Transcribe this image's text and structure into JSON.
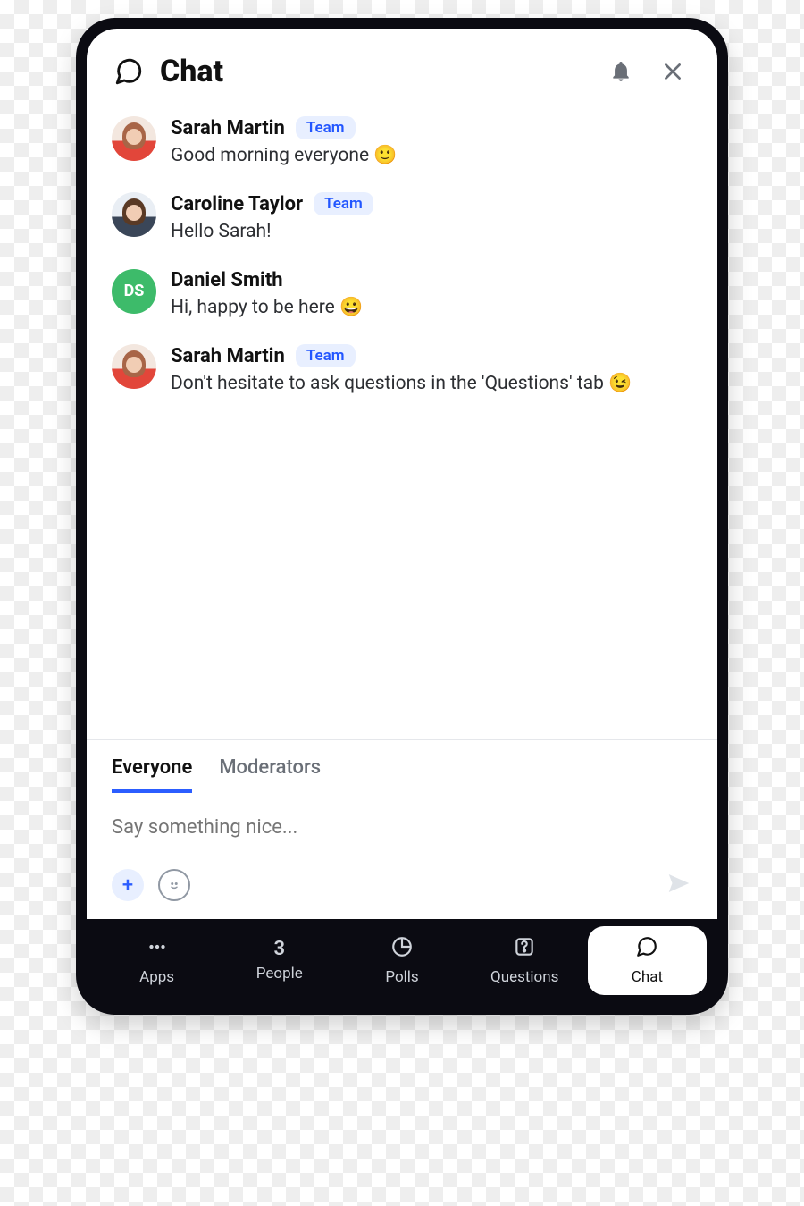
{
  "header": {
    "title": "Chat"
  },
  "badge": "Team",
  "messages": [
    {
      "name": "Sarah Martin",
      "team": true,
      "text": "Good morning everyone 🙂",
      "avatar": "sarah"
    },
    {
      "name": "Caroline Taylor",
      "team": true,
      "text": "Hello Sarah!",
      "avatar": "caroline"
    },
    {
      "name": "Daniel Smith",
      "team": false,
      "text": "Hi, happy to be here 😀",
      "avatar": "initials",
      "initials": "DS"
    },
    {
      "name": "Sarah Martin",
      "team": true,
      "text": "Don't hesitate to ask questions in the 'Questions' tab 😉",
      "avatar": "sarah"
    }
  ],
  "compose": {
    "tabs": [
      {
        "label": "Everyone",
        "active": true
      },
      {
        "label": "Moderators",
        "active": false
      }
    ],
    "placeholder": "Say something nice..."
  },
  "nav": {
    "apps": {
      "label": "Apps"
    },
    "people": {
      "label": "People",
      "count": "3"
    },
    "polls": {
      "label": "Polls"
    },
    "questions": {
      "label": "Questions"
    },
    "chat": {
      "label": "Chat"
    }
  }
}
